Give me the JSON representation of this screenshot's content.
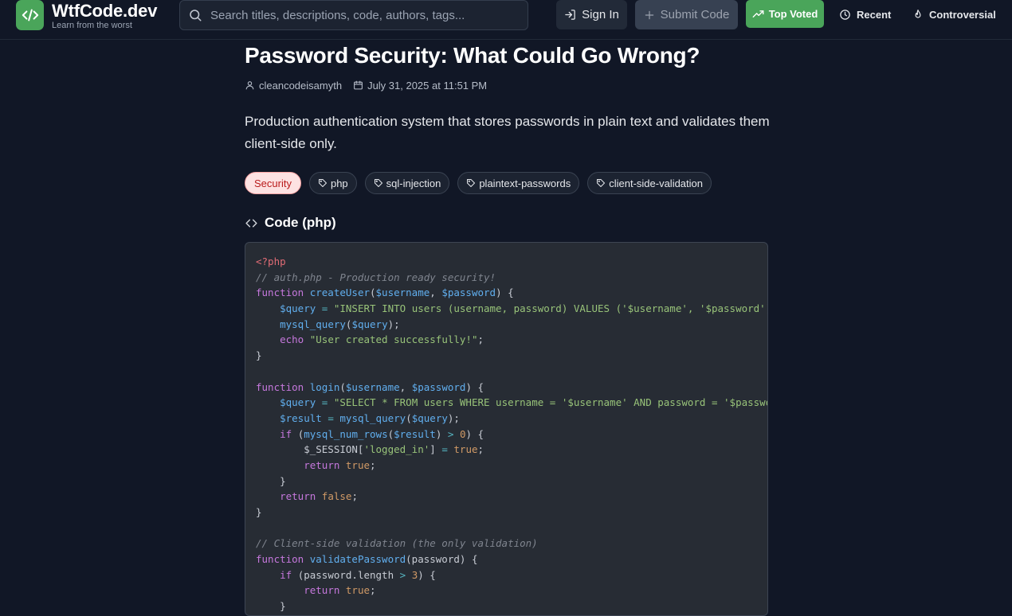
{
  "header": {
    "brand_name": "WtfCode.dev",
    "brand_tagline": "Learn from the worst",
    "search_placeholder": "Search titles, descriptions, code, authors, tags...",
    "sign_in_label": "Sign In",
    "submit_label": "Submit Code",
    "nav": {
      "top_voted": "Top Voted",
      "recent": "Recent",
      "controversial": "Controversial"
    }
  },
  "post": {
    "title": "Password Security: What Could Go Wrong?",
    "author": "cleancodeisamyth",
    "date": "July 31, 2025 at 11:51 PM",
    "description": "Production authentication system that stores passwords in plain text and validates them client-side only.",
    "category": "Security",
    "tags": [
      "php",
      "sql-injection",
      "plaintext-passwords",
      "client-side-validation"
    ],
    "code_heading": "Code (php)",
    "code_lines": [
      [
        [
          "tag",
          "<?php"
        ]
      ],
      [
        [
          "cm",
          "// auth.php - Production ready security!"
        ]
      ],
      [
        [
          "kw",
          "function "
        ],
        [
          "fn",
          "createUser"
        ],
        [
          "pl",
          "("
        ],
        [
          "var",
          "$username"
        ],
        [
          "pl",
          ", "
        ],
        [
          "var",
          "$password"
        ],
        [
          "pl",
          ") {"
        ]
      ],
      [
        [
          "pl",
          "    "
        ],
        [
          "var",
          "$query"
        ],
        [
          "pl",
          " "
        ],
        [
          "op",
          "="
        ],
        [
          "pl",
          " "
        ],
        [
          "str",
          "\"INSERT INTO users (username, password) VALUES ('$username', '$password')\""
        ],
        [
          "pl",
          ";"
        ]
      ],
      [
        [
          "pl",
          "    "
        ],
        [
          "fn",
          "mysql_query"
        ],
        [
          "pl",
          "("
        ],
        [
          "var",
          "$query"
        ],
        [
          "pl",
          ");"
        ]
      ],
      [
        [
          "pl",
          "    "
        ],
        [
          "kw",
          "echo"
        ],
        [
          "pl",
          " "
        ],
        [
          "str",
          "\"User created successfully!\""
        ],
        [
          "pl",
          ";"
        ]
      ],
      [
        [
          "pl",
          "}"
        ]
      ],
      [
        [
          "pl",
          ""
        ]
      ],
      [
        [
          "kw",
          "function "
        ],
        [
          "fn",
          "login"
        ],
        [
          "pl",
          "("
        ],
        [
          "var",
          "$username"
        ],
        [
          "pl",
          ", "
        ],
        [
          "var",
          "$password"
        ],
        [
          "pl",
          ") {"
        ]
      ],
      [
        [
          "pl",
          "    "
        ],
        [
          "var",
          "$query"
        ],
        [
          "pl",
          " "
        ],
        [
          "op",
          "="
        ],
        [
          "pl",
          " "
        ],
        [
          "str",
          "\"SELECT * FROM users WHERE username = '$username' AND password = '$password'"
        ]
      ],
      [
        [
          "pl",
          "    "
        ],
        [
          "var",
          "$result"
        ],
        [
          "pl",
          " "
        ],
        [
          "op",
          "="
        ],
        [
          "pl",
          " "
        ],
        [
          "fn",
          "mysql_query"
        ],
        [
          "pl",
          "("
        ],
        [
          "var",
          "$query"
        ],
        [
          "pl",
          ");"
        ]
      ],
      [
        [
          "pl",
          "    "
        ],
        [
          "kw",
          "if"
        ],
        [
          "pl",
          " ("
        ],
        [
          "fn",
          "mysql_num_rows"
        ],
        [
          "pl",
          "("
        ],
        [
          "var",
          "$result"
        ],
        [
          "pl",
          ") "
        ],
        [
          "op",
          ">"
        ],
        [
          "pl",
          " "
        ],
        [
          "num",
          "0"
        ],
        [
          "pl",
          ") {"
        ]
      ],
      [
        [
          "pl",
          "        $_SESSION["
        ],
        [
          "str",
          "'logged_in'"
        ],
        [
          "pl",
          "] "
        ],
        [
          "op",
          "="
        ],
        [
          "pl",
          " "
        ],
        [
          "bool",
          "true"
        ],
        [
          "pl",
          ";"
        ]
      ],
      [
        [
          "pl",
          "        "
        ],
        [
          "kw",
          "return"
        ],
        [
          "pl",
          " "
        ],
        [
          "bool",
          "true"
        ],
        [
          "pl",
          ";"
        ]
      ],
      [
        [
          "pl",
          "    }"
        ]
      ],
      [
        [
          "pl",
          "    "
        ],
        [
          "kw",
          "return"
        ],
        [
          "pl",
          " "
        ],
        [
          "bool",
          "false"
        ],
        [
          "pl",
          ";"
        ]
      ],
      [
        [
          "pl",
          "}"
        ]
      ],
      [
        [
          "pl",
          ""
        ]
      ],
      [
        [
          "cm",
          "// Client-side validation (the only validation)"
        ]
      ],
      [
        [
          "kw",
          "function "
        ],
        [
          "fn",
          "validatePassword"
        ],
        [
          "pl",
          "(password) {"
        ]
      ],
      [
        [
          "pl",
          "    "
        ],
        [
          "kw",
          "if"
        ],
        [
          "pl",
          " (password.length "
        ],
        [
          "op",
          ">"
        ],
        [
          "pl",
          " "
        ],
        [
          "num",
          "3"
        ],
        [
          "pl",
          ") {"
        ]
      ],
      [
        [
          "pl",
          "        "
        ],
        [
          "kw",
          "return"
        ],
        [
          "pl",
          " "
        ],
        [
          "bool",
          "true"
        ],
        [
          "pl",
          ";"
        ]
      ],
      [
        [
          "pl",
          "    }"
        ]
      ]
    ]
  },
  "icons": {
    "logo": "code-brackets-icon",
    "search": "search-icon",
    "sign_in": "login-arrow-icon",
    "submit": "plus-icon",
    "top_voted": "trending-up-icon",
    "recent": "clock-icon",
    "controversial": "flame-icon",
    "author": "user-icon",
    "date": "calendar-icon",
    "tag": "tag-icon",
    "code": "code-icon"
  },
  "colors": {
    "background": "#111726",
    "accent_green": "#4aa55a",
    "category_bg": "#fde2e2",
    "category_text": "#b91c1c",
    "code_bg": "#272c34"
  }
}
